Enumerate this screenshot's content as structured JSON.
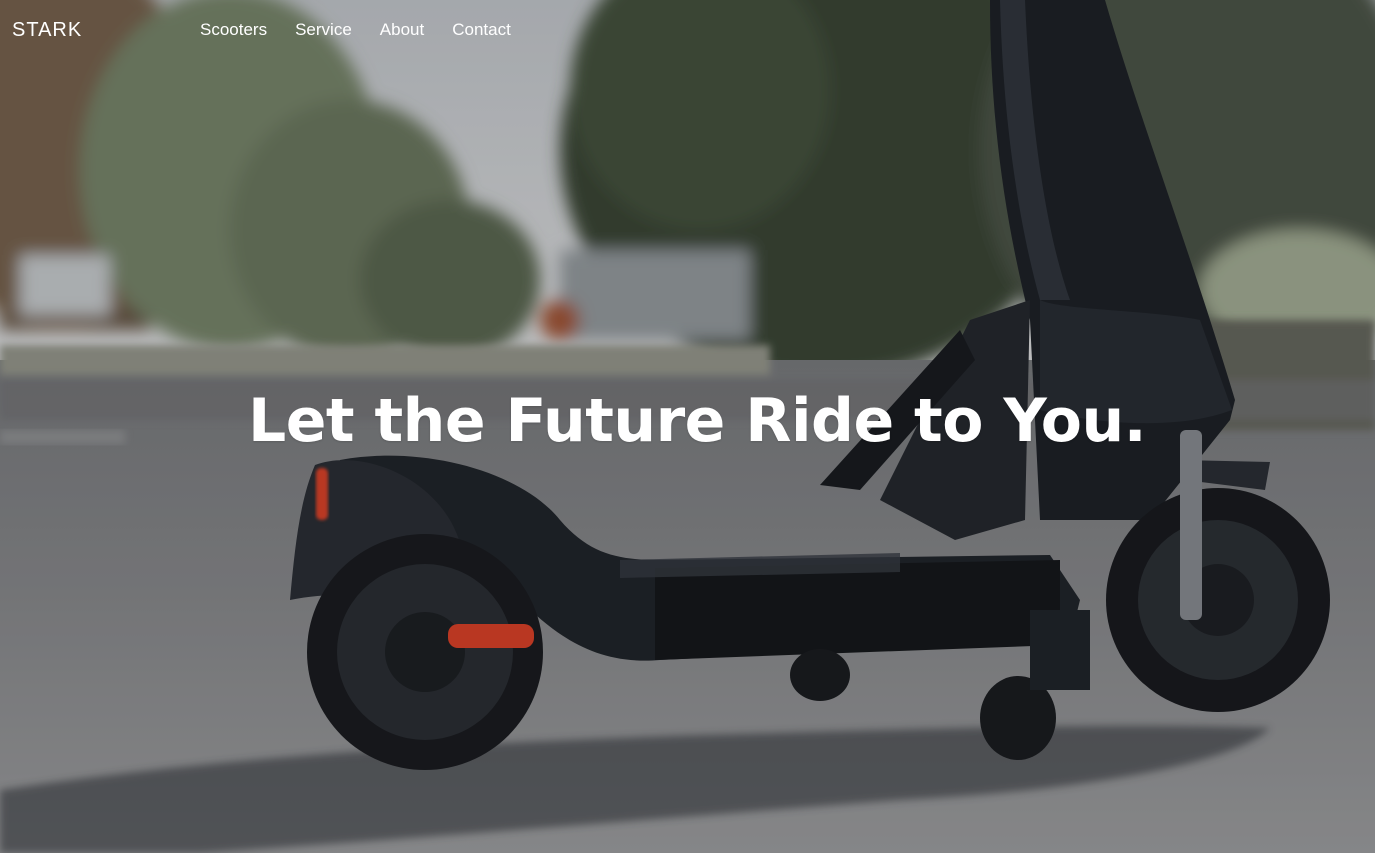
{
  "brand": {
    "logo_text": "STARK"
  },
  "nav": {
    "items": [
      {
        "label": "Scooters"
      },
      {
        "label": "Service"
      },
      {
        "label": "About"
      },
      {
        "label": "Contact"
      }
    ]
  },
  "hero": {
    "headline": "Let the Future Ride to You.",
    "background_image": "electric-scooter-photo"
  },
  "colors": {
    "text": "#ffffff",
    "road": "#8a8c8e",
    "scooter": "#1e2126",
    "tail_light": "#e2442a"
  }
}
